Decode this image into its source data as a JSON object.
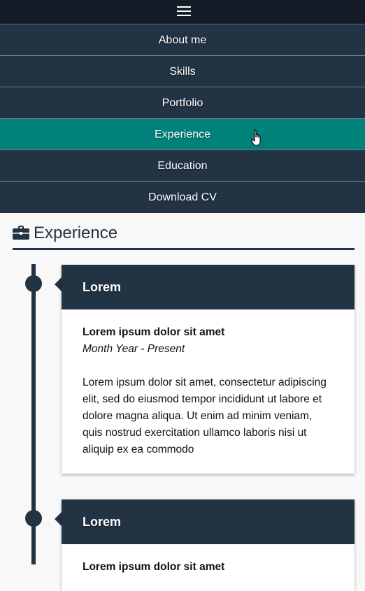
{
  "nav": {
    "items": [
      {
        "label": "About me",
        "active": false
      },
      {
        "label": "Skills",
        "active": false
      },
      {
        "label": "Portfolio",
        "active": false
      },
      {
        "label": "Experience",
        "active": true
      },
      {
        "label": "Education",
        "active": false
      },
      {
        "label": "Download CV",
        "active": false
      }
    ]
  },
  "section": {
    "title": "Experience",
    "icon": "briefcase-icon"
  },
  "experience": [
    {
      "company": "Lorem",
      "title": "Lorem ipsum dolor sit amet",
      "date": "Month Year - Present",
      "description": "Lorem ipsum dolor sit amet, consectetur adipiscing elit, sed do eiusmod tempor incididunt ut labore et dolore magna aliqua. Ut enim ad minim veniam, quis nostrud exercitation ullamco laboris nisi ut aliquip ex ea commodo"
    },
    {
      "company": "Lorem",
      "title": "Lorem ipsum dolor sit amet"
    }
  ],
  "colors": {
    "navy": "#223344",
    "teal": "#00827a",
    "topbar": "#141c27"
  }
}
